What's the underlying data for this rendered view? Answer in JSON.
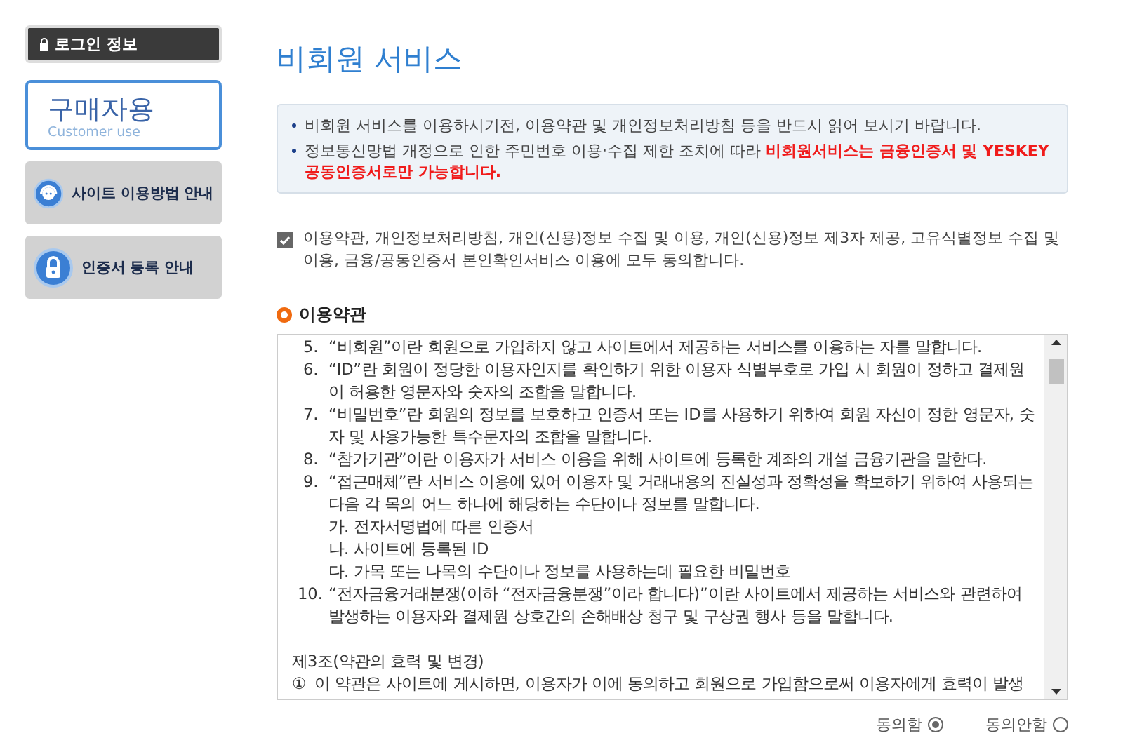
{
  "sidebar": {
    "login_button": "로그인 정보",
    "user_type": {
      "title": "구매자용",
      "subtitle": "Customer use"
    },
    "items": [
      {
        "label": "사이트 이용방법 안내",
        "kind": "support"
      },
      {
        "label": "인증서 등록 안내",
        "kind": "lock"
      }
    ]
  },
  "page_title": "비회원 서비스",
  "notices": [
    "비회원 서비스를 이용하시기전, 이용약관 및 개인정보처리방침 등을 반드시 읽어 보시기 바랍니다.",
    "정보통신망법 개정으로 인한 주민번호 이용·수집 제한 조치에 따라 **비회원서비스는 금융인증서 및 YESKEY 공동인증서로만 가능합니다.**"
  ],
  "agreement": {
    "label": "이용약관, 개인정보처리방침, 개인(신용)정보 수집 및 이용, 개인(신용)정보 제3자 제공, 고유식별정보 수집 및 이용, 금융/공동인증서 본인확인서비스 이용에 모두 동의합니다.",
    "checked": true
  },
  "terms": {
    "heading": "이용약관",
    "lines": [
      {
        "kind": "item",
        "number": "5.",
        "text": "“비회원”이란 회원으로 가입하지 않고 사이트에서 제공하는 서비스를 이용하는 자를 말합니다."
      },
      {
        "kind": "item",
        "number": "6.",
        "text": "“ID”란 회원이 정당한 이용자인지를 확인하기 위한 이용자 식별부호로 가입 시 회원이 정하고 결제원이 허용한 영문자와 숫자의 조합을 말합니다."
      },
      {
        "kind": "item",
        "number": "7.",
        "text": "“비밀번호”란 회원의 정보를 보호하고 인증서 또는 ID를 사용하기 위하여 회원 자신이 정한 영문자, 숫자 및 사용가능한 특수문자의 조합을 말합니다."
      },
      {
        "kind": "item",
        "number": "8.",
        "text": "“참가기관”이란 이용자가 서비스 이용을 위해 사이트에 등록한 계좌의 개설 금융기관을 말한다."
      },
      {
        "kind": "item",
        "number": "9.",
        "text": "“접근매체”란 서비스 이용에 있어 이용자 및 거래내용의 진실성과 정확성을 확보하기 위하여 사용되는 다음 각 목의 어느 하나에 해당하는 수단이나 정보를 말합니다."
      },
      {
        "kind": "sub",
        "number": "가.",
        "text": "전자서명법에 따른 인증서"
      },
      {
        "kind": "sub",
        "number": "나.",
        "text": "사이트에 등록된 ID"
      },
      {
        "kind": "sub",
        "number": "다.",
        "text": "가목 또는 나목의 수단이나 정보를 사용하는데 필요한 비밀번호"
      },
      {
        "kind": "item",
        "number": "10.",
        "text": "“전자금융거래분쟁(이하 “전자금융분쟁”이라 합니다)”이란 사이트에서 제공하는 서비스와 관련하여 발생하는 이용자와 결제원 상호간의 손해배상 청구 및 구상권 행사 등을 말합니다."
      },
      {
        "kind": "article",
        "text": "제3조(약관의 효력 및 변경)"
      },
      {
        "kind": "paragraph",
        "number": "①",
        "text": "이 약관은 사이트에 게시하면, 이용자가 이에 동의하고 회원으로 가입함으로써 이용자에게 효력이 발생"
      }
    ]
  },
  "consent_options": [
    {
      "label": "동의함",
      "selected": true
    },
    {
      "label": "동의안함",
      "selected": false
    }
  ]
}
